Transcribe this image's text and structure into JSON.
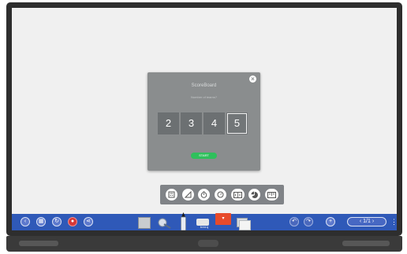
{
  "scoreboard": {
    "title": "ScoreBoard",
    "subtitle": "Number of teams?",
    "close_symbol": "×",
    "options": [
      "2",
      "3",
      "4",
      "5"
    ],
    "selected_option": "5",
    "start_label": "START"
  },
  "toolbar": {
    "brand": "benq",
    "page_indicator": "1/1",
    "menu_symbol": "⋮",
    "prev_symbol": "‹",
    "next_symbol": "›",
    "add_symbol": "+",
    "tab_symbol": "▾"
  },
  "colors": {
    "taskbar": "#2f59b8",
    "dialog": "#8a8d8e",
    "start_button": "#2fc05c",
    "accent_tab": "#e74a2a"
  },
  "icons": {
    "floating_tools": [
      "calculator-icon",
      "pen-tool-icon",
      "timer-icon",
      "stopwatch-icon",
      "scoreboard-icon",
      "pie-chart-icon",
      "ruler-icon"
    ],
    "taskbar_left": [
      "back-icon",
      "whiteboard-icon",
      "rotate-icon",
      "record-icon",
      "share-icon"
    ],
    "taskbar_right": [
      "undo-icon",
      "redo-icon"
    ]
  }
}
